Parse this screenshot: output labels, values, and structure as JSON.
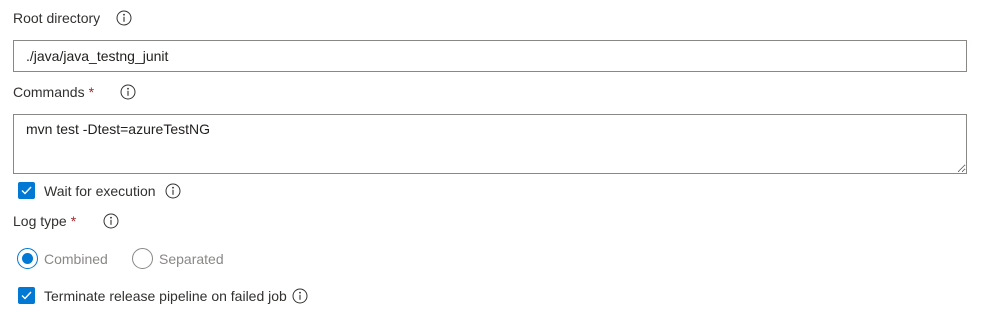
{
  "root_directory": {
    "label": "Root directory",
    "value": "./java/java_testng_junit"
  },
  "commands": {
    "label": "Commands",
    "required_marker": "*",
    "value": "mvn test -Dtest=azureTestNG"
  },
  "wait_for_execution": {
    "label": "Wait for execution",
    "checked": true
  },
  "log_type": {
    "label": "Log type",
    "required_marker": "*",
    "options": [
      {
        "label": "Combined",
        "selected": true
      },
      {
        "label": "Separated",
        "selected": false
      }
    ]
  },
  "terminate_on_failure": {
    "label": "Terminate release pipeline on failed job",
    "checked": true
  },
  "icons": {
    "info": "info-icon",
    "check": "checkmark-icon"
  },
  "colors": {
    "accent": "#0078d4",
    "required": "#a4262c",
    "text": "#323130",
    "disabled_text": "#8a8886",
    "border": "#8a8886"
  }
}
